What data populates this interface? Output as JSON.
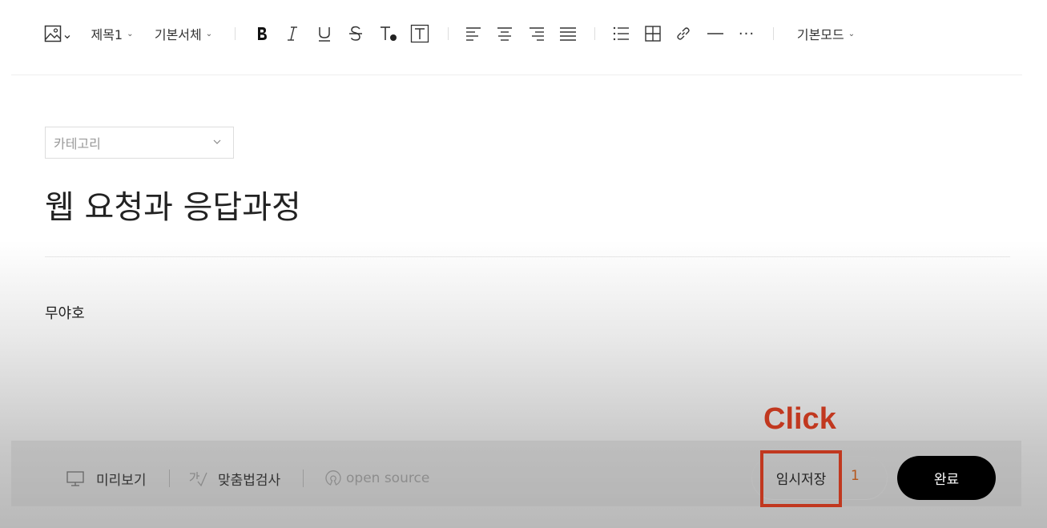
{
  "toolbar": {
    "heading_dropdown": "제목1",
    "font_dropdown": "기본서체",
    "mode_dropdown": "기본모드",
    "chevron_glyph": "⌄",
    "more_glyph": "···",
    "icons": [
      "image-icon",
      "bold-icon",
      "italic-icon",
      "underline-icon",
      "strikethrough-icon",
      "text-color-icon",
      "text-background-icon",
      "align-left-icon",
      "align-center-icon",
      "align-right-icon",
      "align-justify-icon",
      "bulleted-list-icon",
      "table-icon",
      "link-icon",
      "horizontal-rule-icon",
      "more-icon"
    ]
  },
  "editor": {
    "category_placeholder": "카테고리",
    "title": "웹 요청과 응답과정",
    "body": "무야호"
  },
  "bottom": {
    "preview": "미리보기",
    "spellcheck": "맞춤법검사",
    "opensource": "open source",
    "temp_save": "임시저장",
    "temp_save_count": "1",
    "done": "완료"
  },
  "annotation": {
    "label": "Click",
    "color": "#c1381f"
  },
  "colors": {
    "accent": "#c1381f",
    "count": "#b5561b",
    "done_bg": "#000000"
  }
}
